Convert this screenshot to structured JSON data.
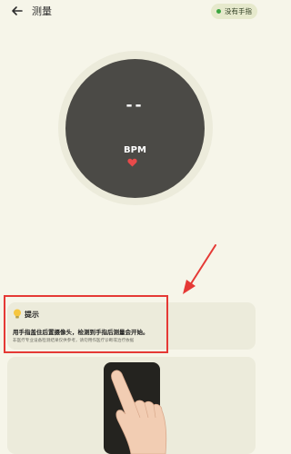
{
  "header": {
    "title": "测量",
    "status_chip": "没有手指"
  },
  "gauge": {
    "reading": "--",
    "unit": "BPM"
  },
  "tip": {
    "title": "提示",
    "main": "用手指盖住后置摄像头，检测到手指后测量会开始。",
    "note": "非医疗专业设备检测结果仅供参考，请勿用作医疗诊断或治疗依据"
  },
  "icons": {
    "back": "arrow-left-icon",
    "heart": "heart-icon",
    "bulb": "lightbulb-icon"
  },
  "colors": {
    "background": "#f6f5e9",
    "gauge_face": "#4b4a46",
    "heart": "#e84a4a",
    "highlight": "#e53935",
    "status_dot": "#3aa540"
  }
}
